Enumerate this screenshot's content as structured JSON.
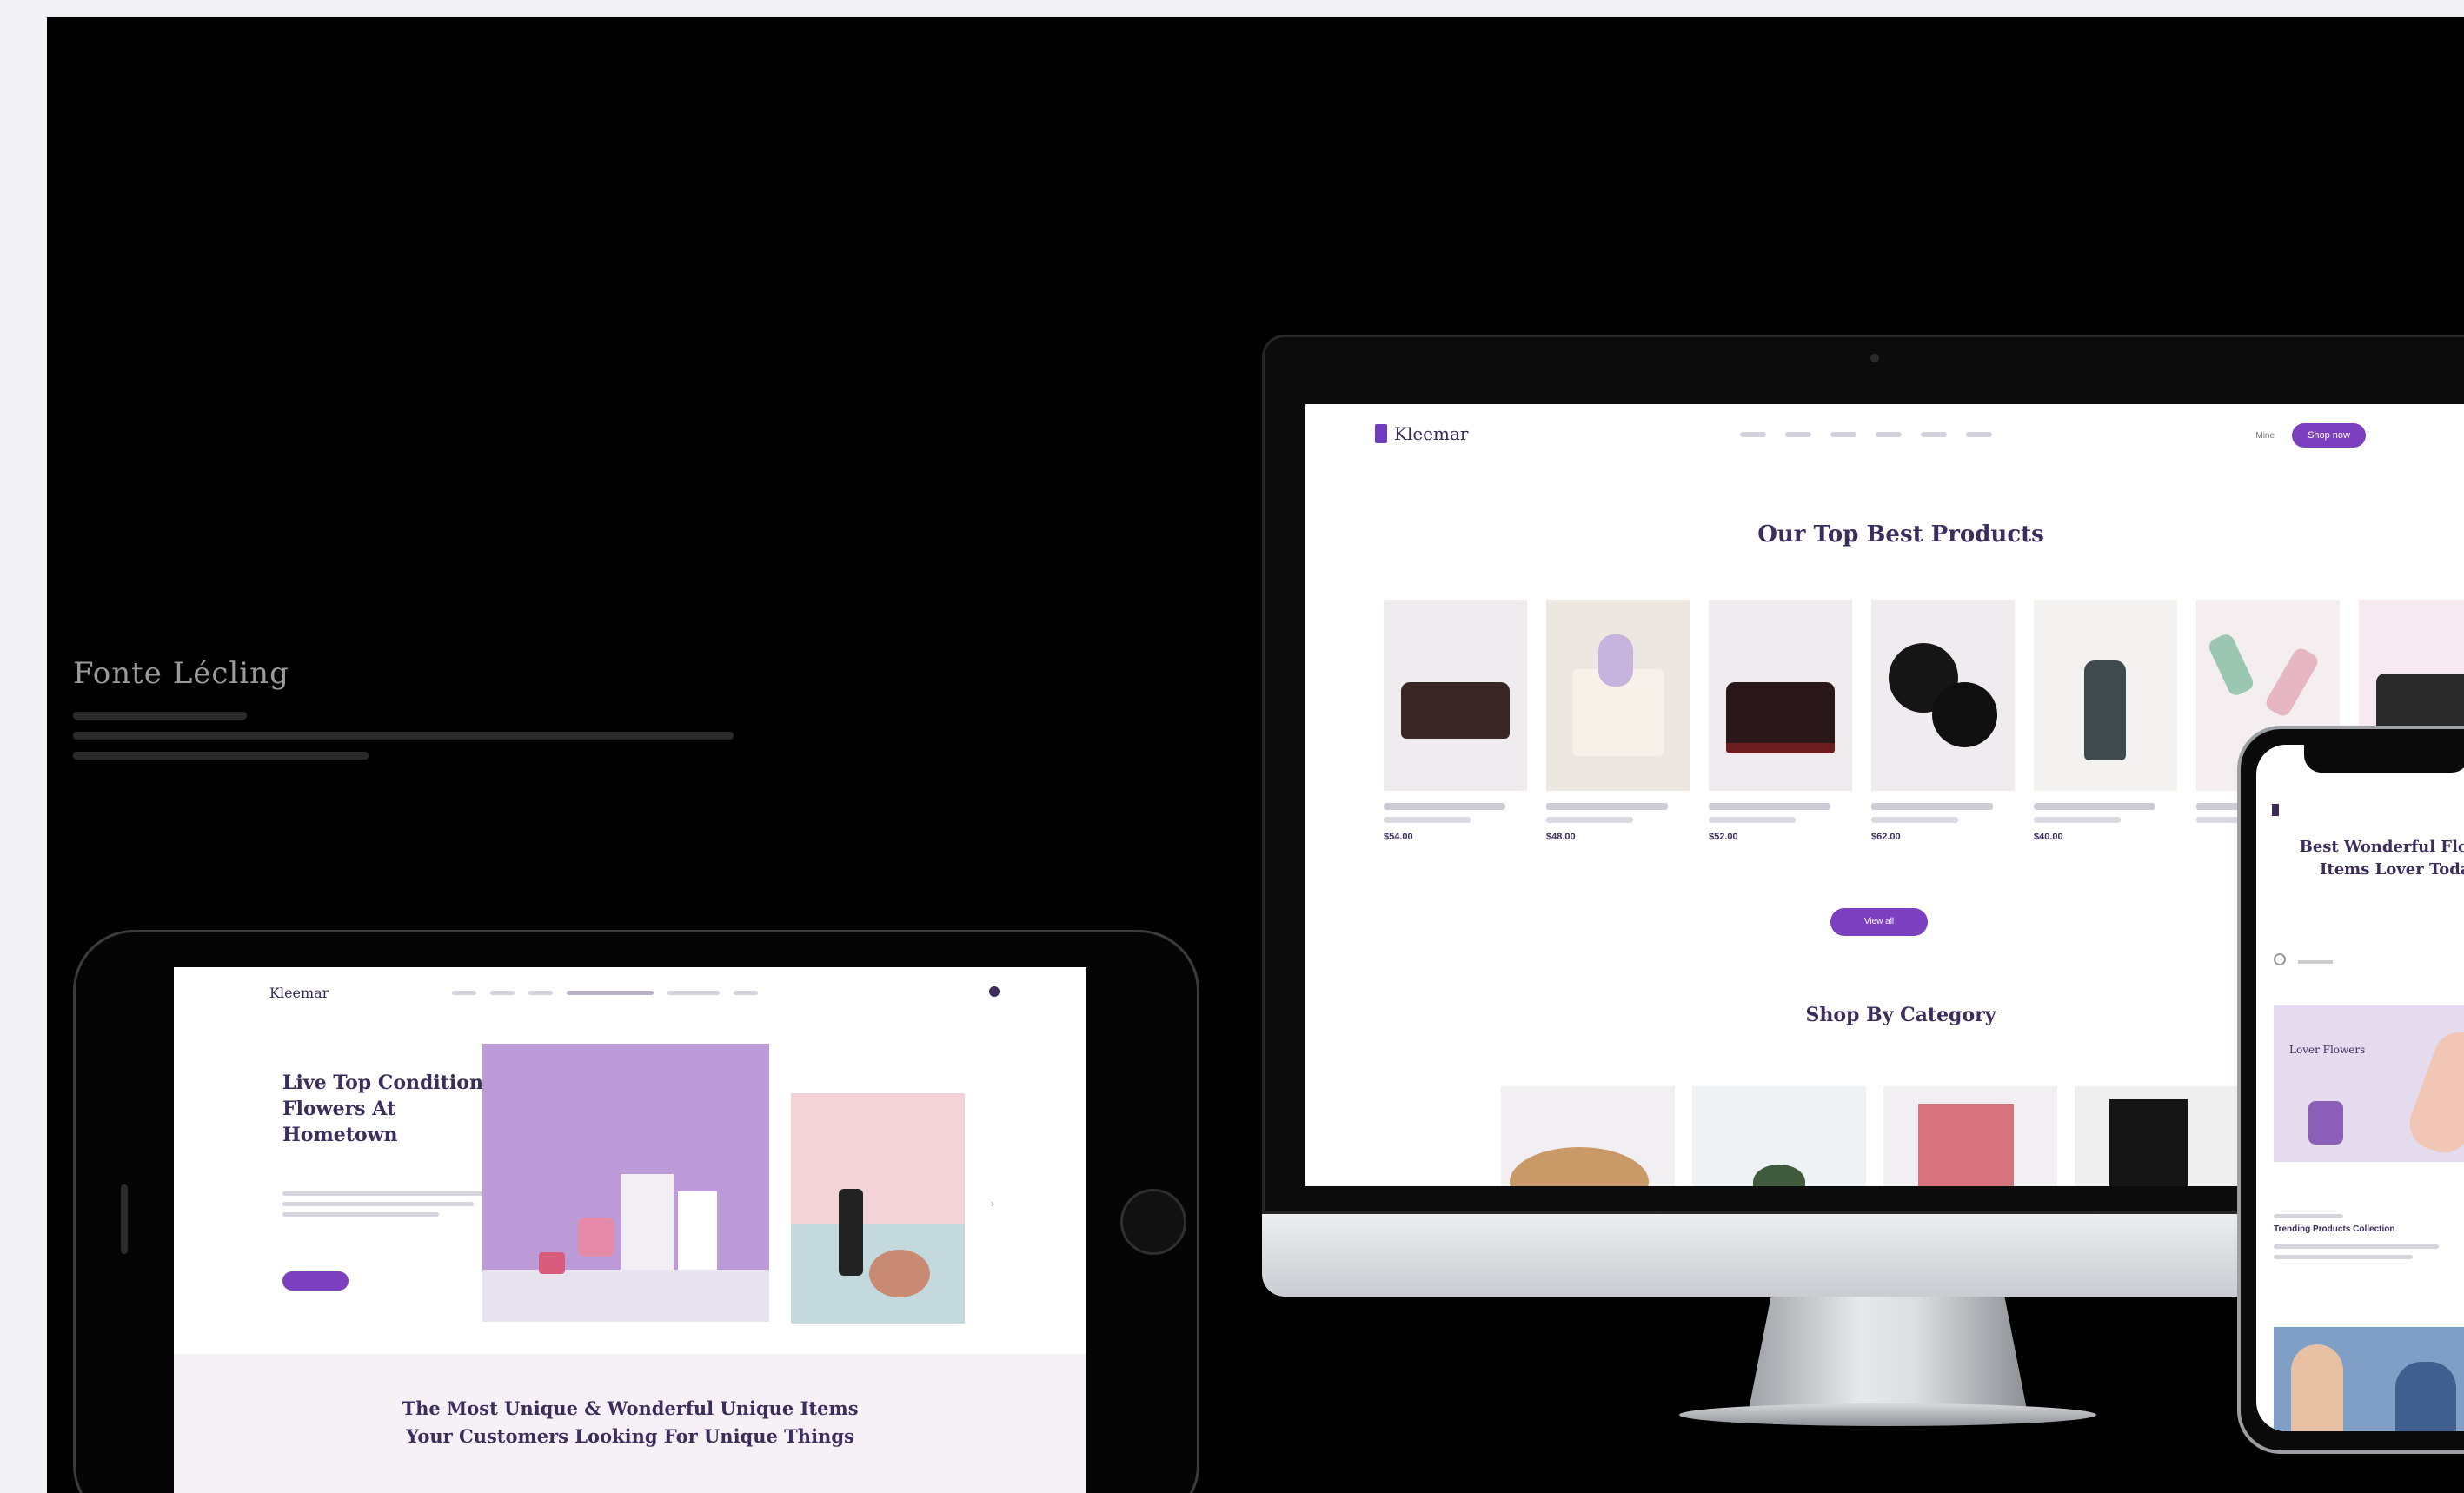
{
  "caption": {
    "title": "Fonte Lécling"
  },
  "desktop": {
    "logo_text": "Kleemar",
    "nav_login": "Mine",
    "nav_cta": "Shop now",
    "section1_title": "Our Top Best Products",
    "products": [
      {
        "price": "$54.00"
      },
      {
        "price": "$48.00"
      },
      {
        "price": "$52.00"
      },
      {
        "price": "$62.00"
      },
      {
        "price": "$40.00"
      },
      {
        "price": ""
      },
      {
        "price": ""
      }
    ],
    "view_all": "View all",
    "section2_title": "Shop By Category"
  },
  "tablet": {
    "logo_text": "Kleemar",
    "hero_heading": "Live Top Conditioned Flowers At Hometown",
    "band_line1": "The Most Unique & Wonderful Unique Items",
    "band_line2": "Your Customers Looking For Unique Things"
  },
  "phone": {
    "heading": "Best Wonderful Flower Items Lover Today",
    "card_title": "Lover Flowers",
    "section_text": "Trending Products Collection"
  },
  "colors": {
    "accent": "#7b3fbf",
    "heading": "#3c2d5c",
    "background": "#000000"
  }
}
